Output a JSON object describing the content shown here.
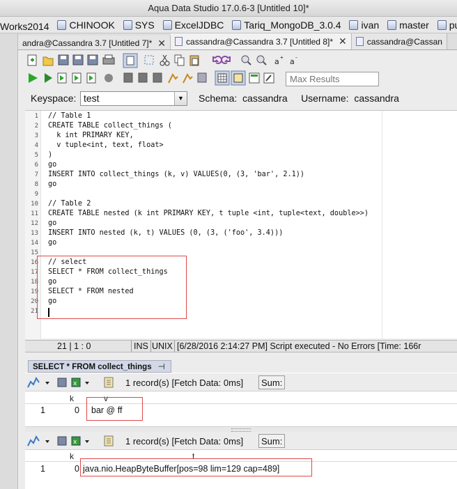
{
  "window": {
    "title": "Aqua Data Studio 17.0.6-3 [Untitled 10]*"
  },
  "connections": [
    {
      "label": "Works2014"
    },
    {
      "label": "CHINOOK"
    },
    {
      "label": "SYS"
    },
    {
      "label": "ExcelJDBC"
    },
    {
      "label": "Tariq_MongoDB_3.0.4"
    },
    {
      "label": "ivan"
    },
    {
      "label": "master"
    },
    {
      "label": "public"
    }
  ],
  "tabs": [
    {
      "label": "andra@Cassandra 3.7 [Untitled 7]*"
    },
    {
      "label": "cassandra@Cassandra 3.7 [Untitled 8]*"
    },
    {
      "label": "cassandra@Cassan"
    }
  ],
  "toolbar": {
    "max_results_placeholder": "Max Results"
  },
  "keyspace": {
    "label": "Keyspace:",
    "value": "test",
    "schema_text": "Schema:  cassandra     Username:  cassandra"
  },
  "editor": {
    "lines": [
      {
        "n": "1",
        "text": "// Table 1"
      },
      {
        "n": "2",
        "text": "CREATE TABLE collect_things ("
      },
      {
        "n": "3",
        "text": "  k int PRIMARY KEY,"
      },
      {
        "n": "4",
        "text": "  v tuple<int, text, float>"
      },
      {
        "n": "5",
        "text": ")"
      },
      {
        "n": "6",
        "text": "go"
      },
      {
        "n": "7",
        "text": "INSERT INTO collect_things (k, v) VALUES(0, (3, 'bar', 2.1))"
      },
      {
        "n": "8",
        "text": "go"
      },
      {
        "n": "9",
        "text": ""
      },
      {
        "n": "10",
        "text": "// Table 2"
      },
      {
        "n": "11",
        "text": "CREATE TABLE nested (k int PRIMARY KEY, t tuple <int, tuple<text, double>>)"
      },
      {
        "n": "12",
        "text": "go"
      },
      {
        "n": "13",
        "text": "INSERT INTO nested (k, t) VALUES (0, (3, ('foo', 3.4)))"
      },
      {
        "n": "14",
        "text": "go"
      },
      {
        "n": "15",
        "text": ""
      },
      {
        "n": "16",
        "text": "// select"
      },
      {
        "n": "17",
        "text": "SELECT * FROM collect_things"
      },
      {
        "n": "18",
        "text": "go"
      },
      {
        "n": "19",
        "text": "SELECT * FROM nested"
      },
      {
        "n": "20",
        "text": "go"
      },
      {
        "n": "21",
        "text": ""
      }
    ]
  },
  "status": {
    "position": "21 | 1 : 0",
    "ins": "INS",
    "unix": "UNIX",
    "message": "[6/28/2016 2:14:27 PM] Script executed - No Errors [Time: 166r"
  },
  "results": {
    "tab_label": "SELECT * FROM collect_things",
    "grids": [
      {
        "records": "1 record(s) [Fetch Data: 0ms]",
        "sum_label": "Sum:",
        "columns": [
          "k",
          "v"
        ],
        "rows": [
          {
            "num": "1",
            "k": "0",
            "v": "bar @ ff"
          }
        ]
      },
      {
        "records": "1 record(s) [Fetch Data: 0ms]",
        "sum_label": "Sum:",
        "columns": [
          "k",
          "t"
        ],
        "rows": [
          {
            "num": "1",
            "k": "0",
            "t": "java.nio.HeapByteBuffer[pos=98 lim=129 cap=489]"
          }
        ]
      }
    ]
  }
}
